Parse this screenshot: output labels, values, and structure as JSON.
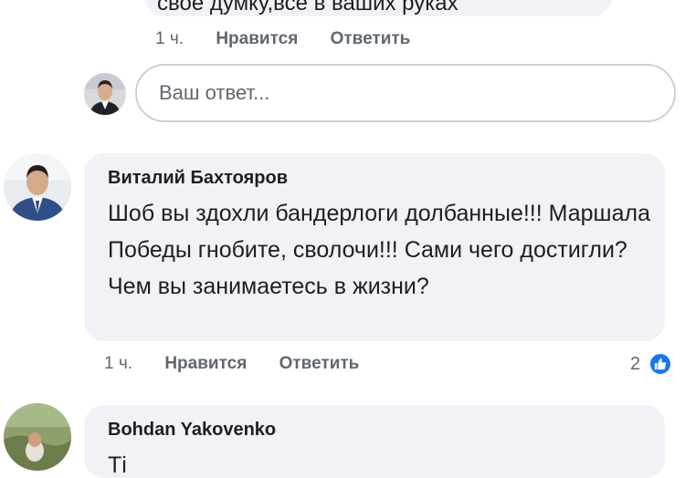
{
  "previous_comment": {
    "text_cut": "своё думку,всё в ваших руках",
    "actions": {
      "time": "1 ч.",
      "like": "Нравится",
      "reply": "Ответить"
    }
  },
  "reply_box": {
    "placeholder": "Ваш ответ..."
  },
  "comment": {
    "author": "Виталий Бахтояров",
    "text": "Шоб вы здохли бандерлоги долбанные!!! Маршала Победы гнобите, сволочи!!! Сами чего достигли? Чем вы занимаетесь в жизни?",
    "actions": {
      "time": "1 ч.",
      "like": "Нравится",
      "reply": "Ответить"
    },
    "reaction_count": "2",
    "reaction_icon": "thumbs-up-icon",
    "reaction_color": "#1877f2"
  },
  "next_comment": {
    "author": "Bohdan Yakovenko",
    "text_cut": "Ті"
  }
}
